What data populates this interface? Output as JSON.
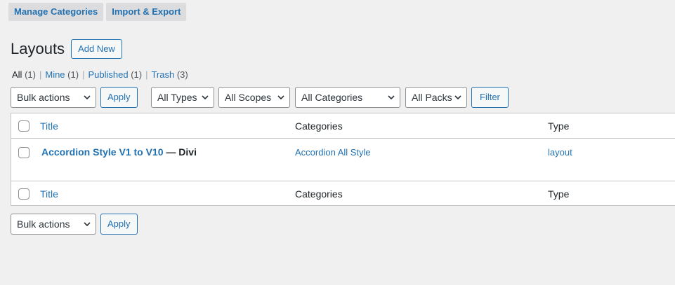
{
  "topnav": {
    "manage_categories": "Manage Categories",
    "import_export": "Import & Export"
  },
  "page": {
    "title": "Layouts",
    "add_new": "Add New"
  },
  "views": [
    {
      "label": "All",
      "count": "(1)"
    },
    {
      "label": "Mine",
      "count": "(1)"
    },
    {
      "label": "Published",
      "count": "(1)"
    },
    {
      "label": "Trash",
      "count": "(3)"
    }
  ],
  "separator": "|",
  "filters": {
    "bulk_actions": "Bulk actions",
    "apply": "Apply",
    "types": "All Types",
    "scopes": "All Scopes",
    "categories": "All Categories",
    "packs": "All Packs",
    "filter": "Filter"
  },
  "table": {
    "columns": {
      "title": "Title",
      "categories": "Categories",
      "type": "Type"
    },
    "rows": [
      {
        "title": "Accordion Style V1 to V10",
        "suffix": " — Divi",
        "categories": "Accordion All Style",
        "type": "layout"
      }
    ]
  },
  "colors": {
    "link": "#2271b1",
    "background": "#f0f0f1",
    "border": "#c3c4c7"
  }
}
